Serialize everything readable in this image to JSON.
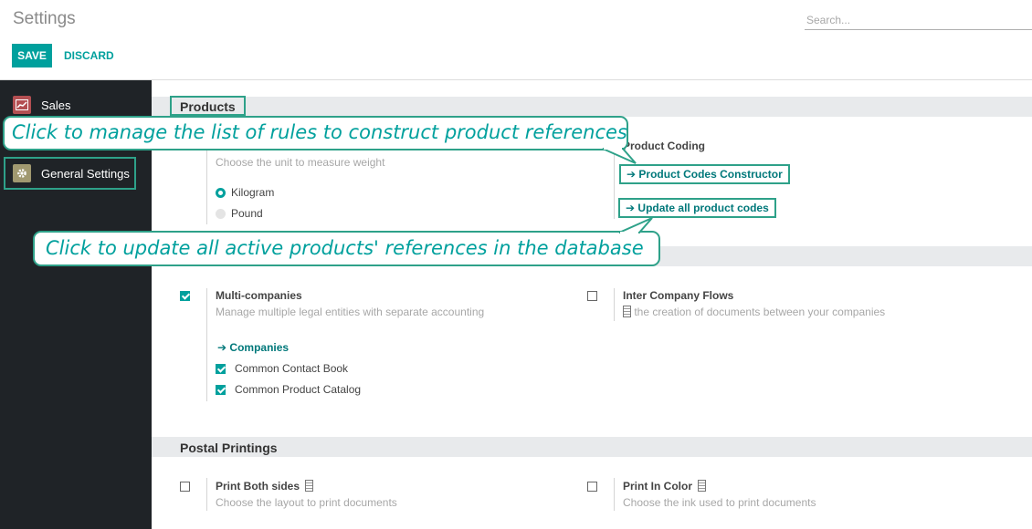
{
  "header": {
    "title": "Settings",
    "search_placeholder": "Search...",
    "save_label": "SAVE",
    "discard_label": "DISCARD"
  },
  "sidebar": {
    "items": [
      {
        "label": "Sales",
        "icon": "chart-icon"
      },
      {
        "label": "General Settings",
        "icon": "gear-icon",
        "active": true
      }
    ]
  },
  "products": {
    "title": "Products",
    "weight_desc": "Choose the unit to measure weight",
    "weight_options": [
      {
        "label": "Kilogram",
        "selected": true
      },
      {
        "label": "Pound",
        "selected": false
      }
    ],
    "coding_title": "Product Coding",
    "codes_constructor_link": "Product Codes Constructor",
    "update_codes_link": "Update all product codes"
  },
  "companies": {
    "multi_title": "Multi-companies",
    "multi_desc": "Manage multiple legal entities with separate accounting",
    "multi_checked": true,
    "companies_link": "Companies",
    "contact_book": "Common Contact Book",
    "product_catalog": "Common Product Catalog",
    "inter_title": "Inter Company Flows",
    "inter_desc": "the creation of documents between your companies",
    "inter_checked": false
  },
  "postal": {
    "title": "Postal Printings",
    "both_sides_title": "Print Both sides",
    "both_sides_desc": "Choose the layout to print documents",
    "color_title": "Print In Color",
    "color_desc": "Choose the ink used to print documents"
  },
  "callouts": {
    "top": "Click to manage the list of rules to construct product references",
    "bottom": "Click to update all active products' references in the database"
  },
  "colors": {
    "accent": "#00a09d",
    "callout_border": "#2ea189",
    "sidebar_bg": "#1f2327"
  }
}
